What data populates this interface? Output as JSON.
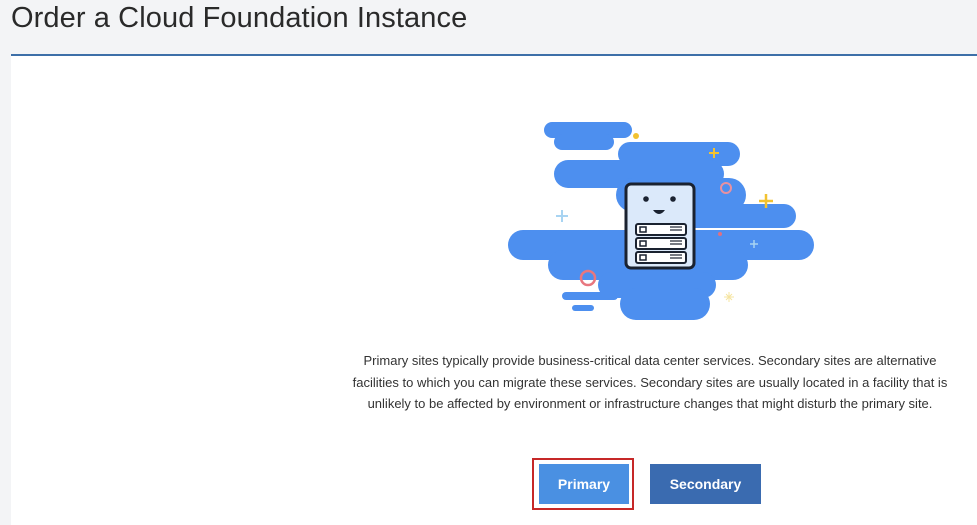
{
  "header": {
    "title": "Order a Cloud Foundation Instance"
  },
  "main": {
    "description": "Primary sites typically provide business-critical data center services. Secondary sites are alternative facilities to which you can migrate these services. Secondary sites are usually located in a facility that is unlikely to be affected by environment or infrastructure changes that might disturb the primary site.",
    "buttons": {
      "primary_label": "Primary",
      "secondary_label": "Secondary"
    }
  },
  "colors": {
    "accent": "#4a90e2",
    "secondary_button": "#3a6bb0",
    "header_rule": "#3d6fa8",
    "highlight": "#c62828"
  },
  "illustration": {
    "icon": "server-cloud-icon"
  }
}
